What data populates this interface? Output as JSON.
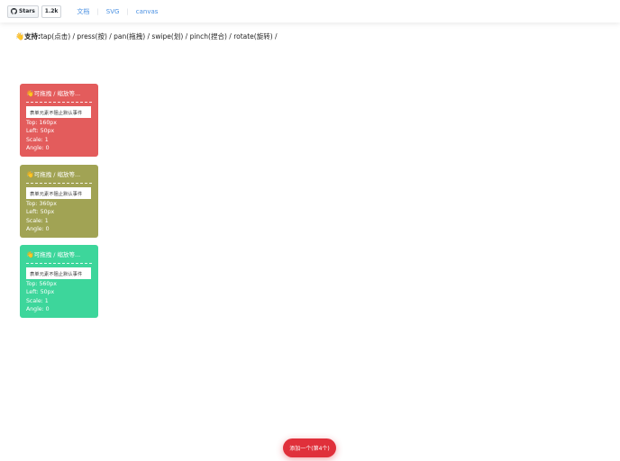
{
  "header": {
    "github": {
      "stars_label": "Stars",
      "stars_count": "1.2k"
    },
    "nav": [
      {
        "label": "文档"
      },
      {
        "label": "SVG"
      },
      {
        "label": "canvas"
      }
    ]
  },
  "support": {
    "label": "支持:",
    "text": "tap(点击) / press(按) / pan(拖拽) / swipe(划) / pinch(捏合) / rotate(旋转) /"
  },
  "cards": [
    {
      "title": "可拖拽 / 缩放等...",
      "input_value": "表单元素不阻止默认事件",
      "top": "Top: 160px",
      "left": "Left: 50px",
      "scale": "Scale: 1",
      "angle": "Angle: 0",
      "color": "#e35c5c"
    },
    {
      "title": "可拖拽 / 缩放等...",
      "input_value": "表单元素不阻止默认事件",
      "top": "Top: 360px",
      "left": "Left: 50px",
      "scale": "Scale: 1",
      "angle": "Angle: 0",
      "color": "#a1a354"
    },
    {
      "title": "可拖拽 / 缩放等...",
      "input_value": "表单元素不阻止默认事件",
      "top": "Top: 560px",
      "left": "Left: 50px",
      "scale": "Scale: 1",
      "angle": "Angle: 0",
      "color": "#3dd69b"
    }
  ],
  "add_button": {
    "label": "添加一个(第4个)",
    "color": "#e0303b"
  },
  "icons": {
    "github": "github-icon",
    "hand": "waving-hand-icon"
  },
  "colors": {
    "nav_link": "#4a90e2"
  }
}
